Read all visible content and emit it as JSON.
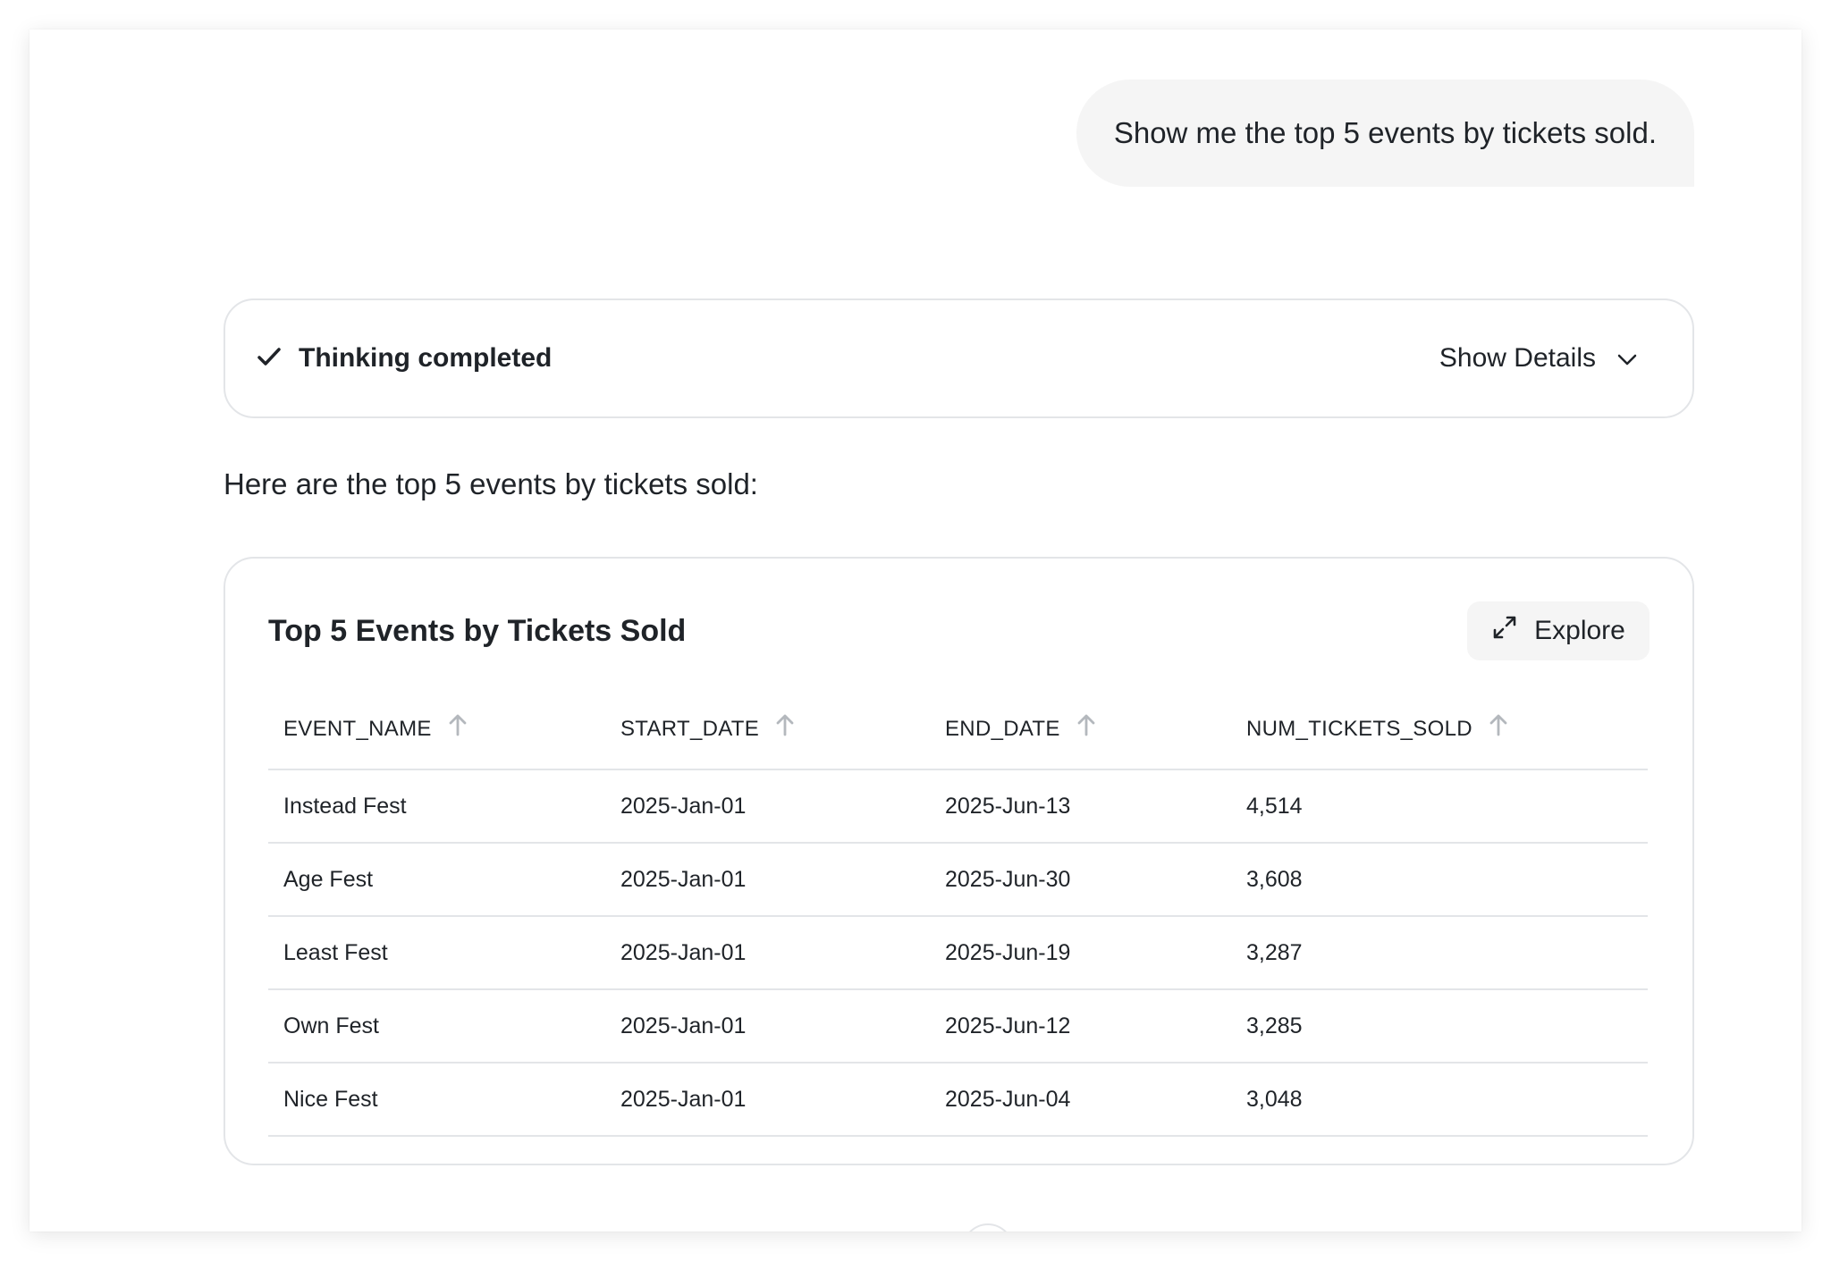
{
  "user_message": "Show me the top 5 events by tickets sold.",
  "thinking": {
    "status_label": "Thinking completed",
    "details_label": "Show Details"
  },
  "answer_text": "Here are the top 5 events by tickets sold:",
  "table_card": {
    "title": "Top 5 Events by Tickets Sold",
    "explore_label": "Explore",
    "columns": [
      "EVENT_NAME",
      "START_DATE",
      "END_DATE",
      "NUM_TICKETS_SOLD"
    ],
    "rows": [
      [
        "Instead Fest",
        "2025-Jan-01",
        "2025-Jun-13",
        "4,514"
      ],
      [
        "Age Fest",
        "2025-Jan-01",
        "2025-Jun-30",
        "3,608"
      ],
      [
        "Least Fest",
        "2025-Jan-01",
        "2025-Jun-19",
        "3,287"
      ],
      [
        "Own Fest",
        "2025-Jan-01",
        "2025-Jun-12",
        "3,285"
      ],
      [
        "Nice Fest",
        "2025-Jan-01",
        "2025-Jun-04",
        "3,048"
      ]
    ]
  },
  "icons": {
    "check": "check-icon",
    "chevron": "chevron-down-icon",
    "expand": "expand-icon",
    "sort": "sort-ascending-icon"
  },
  "colors": {
    "bubble_bg": "#f5f5f5",
    "border": "#e3e5e8",
    "text": "#1f2328",
    "sort_icon": "#b4b8bd"
  }
}
